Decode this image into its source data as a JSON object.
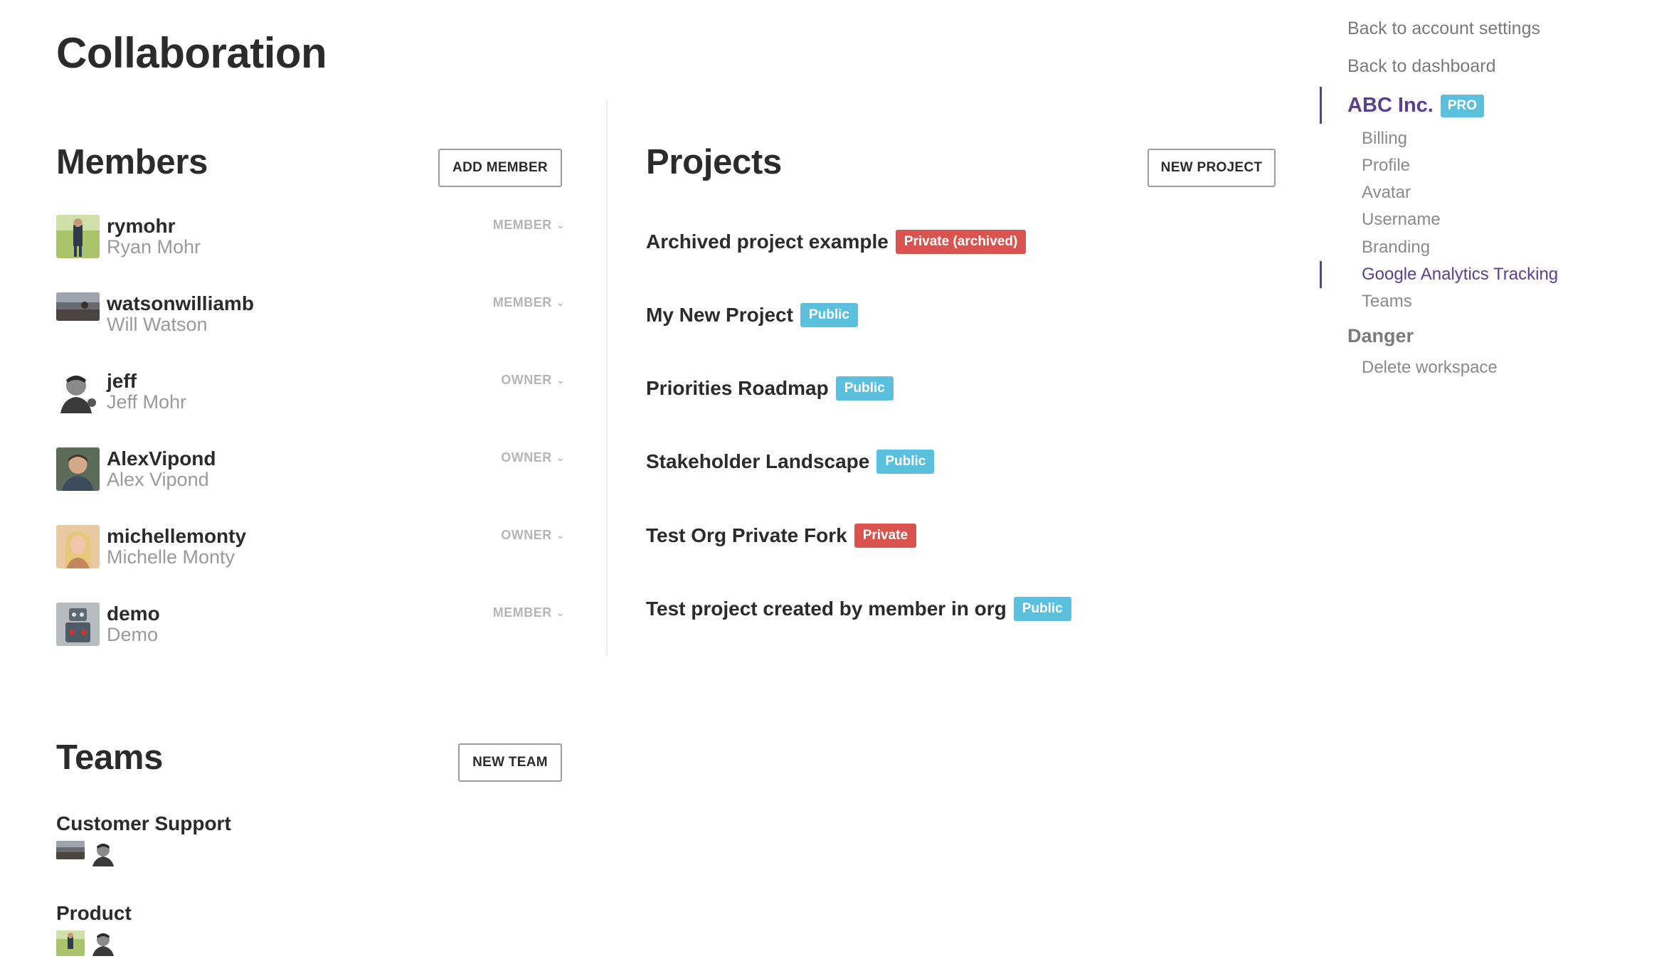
{
  "page": {
    "title": "Collaboration"
  },
  "members": {
    "title": "Members",
    "add_button": "ADD MEMBER",
    "items": [
      {
        "username": "rymohr",
        "fullname": "Ryan Mohr",
        "role": "MEMBER",
        "avatar": "photo-outdoor-man"
      },
      {
        "username": "watsonwilliamb",
        "fullname": "Will Watson",
        "role": "MEMBER",
        "avatar": "photo-landscape"
      },
      {
        "username": "jeff",
        "fullname": "Jeff Mohr",
        "role": "OWNER",
        "avatar": "photo-bw-man"
      },
      {
        "username": "AlexVipond",
        "fullname": "Alex Vipond",
        "role": "OWNER",
        "avatar": "photo-smiling-man"
      },
      {
        "username": "michellemonty",
        "fullname": "Michelle Monty",
        "role": "OWNER",
        "avatar": "photo-blonde-woman"
      },
      {
        "username": "demo",
        "fullname": "Demo",
        "role": "MEMBER",
        "avatar": "photo-robot"
      }
    ]
  },
  "projects": {
    "title": "Projects",
    "new_button": "NEW PROJECT",
    "items": [
      {
        "name": "Archived project example",
        "badge": "Private (archived)",
        "badge_type": "private"
      },
      {
        "name": "My New Project",
        "badge": "Public",
        "badge_type": "public"
      },
      {
        "name": "Priorities Roadmap",
        "badge": "Public",
        "badge_type": "public"
      },
      {
        "name": "Stakeholder Landscape",
        "badge": "Public",
        "badge_type": "public"
      },
      {
        "name": "Test Org Private Fork",
        "badge": "Private",
        "badge_type": "private"
      },
      {
        "name": "Test project created by member in org",
        "badge": "Public",
        "badge_type": "public"
      }
    ]
  },
  "teams": {
    "title": "Teams",
    "new_button": "NEW TEAM",
    "items": [
      {
        "name": "Customer Support",
        "avatars": [
          "photo-landscape",
          "photo-bw-man"
        ]
      },
      {
        "name": "Product",
        "avatars": [
          "photo-outdoor-man",
          "photo-bw-man"
        ]
      }
    ]
  },
  "sidebar": {
    "back_account": "Back to account settings",
    "back_dashboard": "Back to dashboard",
    "org_name": "ABC Inc.",
    "org_badge": "PRO",
    "sub_items": [
      "Billing",
      "Profile",
      "Avatar",
      "Username",
      "Branding",
      "Google Analytics Tracking",
      "Teams"
    ],
    "active_sub": "Google Analytics Tracking",
    "danger_label": "Danger",
    "danger_items": [
      "Delete workspace"
    ]
  },
  "colors": {
    "accent": "#5b3f91",
    "public_badge": "#5bc0de",
    "private_badge": "#d9534f"
  }
}
